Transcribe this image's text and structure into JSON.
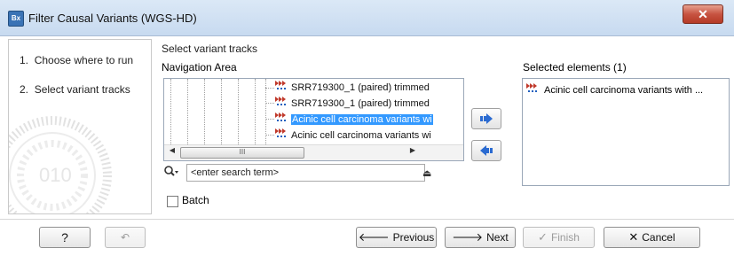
{
  "window": {
    "app_icon": "Bx",
    "title": "Filter Causal Variants (WGS-HD)",
    "close_glyph": "✕"
  },
  "steps": [
    {
      "number": "1.",
      "label": "Choose where to run"
    },
    {
      "number": "2.",
      "label": "Select variant tracks"
    }
  ],
  "main": {
    "section_title": "Select variant tracks",
    "navigation_label": "Navigation Area",
    "tree_items": [
      {
        "label": "SRR719300_1 (paired) trimmed",
        "icon": "variant-track-icon",
        "selected": false
      },
      {
        "label": "SRR719300_1 (paired) trimmed",
        "icon": "variant-track-icon",
        "selected": false
      },
      {
        "label": "Acinic cell carcinoma variants wi",
        "icon": "variant-track-icon",
        "selected": true
      },
      {
        "label": "Acinic cell carcinoma variants wi",
        "icon": "variant-track-icon",
        "selected": false
      }
    ],
    "scroll_glyphs": {
      "up": "▲",
      "down": "▼",
      "left": "◀",
      "right": "▶",
      "grip": "III",
      "vgrip": "≡"
    },
    "search": {
      "placeholder": "<enter search term>",
      "icon": "search-icon",
      "eject_glyph": "⏏"
    },
    "batch_label": "Batch",
    "batch_checked": false
  },
  "selected": {
    "label": "Selected elements (1)",
    "items": [
      {
        "label": "Acinic cell carcinoma variants with ...",
        "icon": "variant-track-icon"
      }
    ]
  },
  "footer": {
    "help_label": "?",
    "undo_glyph": "↶",
    "previous_label": "Previous",
    "previous_glyph": "🡐",
    "next_label": "Next",
    "next_glyph": "🡒",
    "finish_label": "Finish",
    "finish_glyph": "✓",
    "cancel_label": "Cancel",
    "cancel_glyph": "✕"
  },
  "colors": {
    "selection": "#3399ff",
    "arrow_blue": "#2b6bd1",
    "track_icon_red": "#c0392b",
    "track_icon_blue": "#1f5fbf"
  }
}
